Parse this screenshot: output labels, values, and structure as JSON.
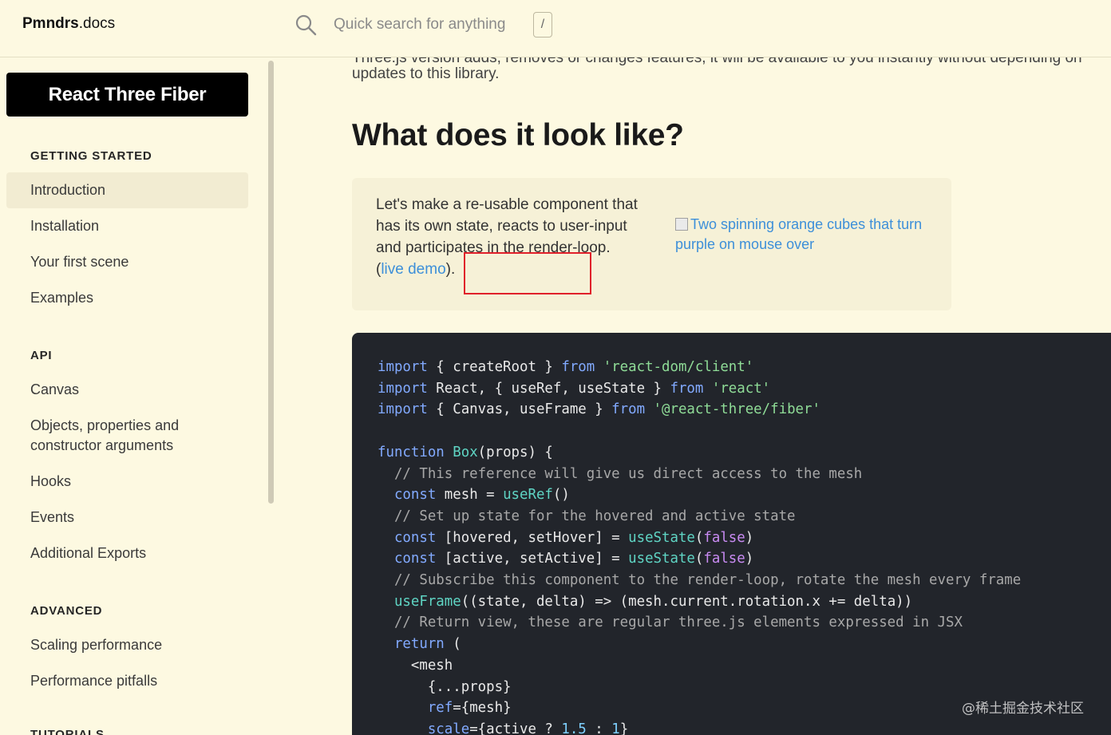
{
  "header": {
    "logo_bold": "Pmndrs",
    "logo_thin": ".docs",
    "search_placeholder": "Quick search for anything",
    "shortcut_key": "/"
  },
  "sidebar": {
    "brand": "React Three Fiber",
    "sections": [
      {
        "title": "GETTING STARTED",
        "items": [
          "Introduction",
          "Installation",
          "Your first scene",
          "Examples"
        ]
      },
      {
        "title": "API",
        "items": [
          "Canvas",
          "Objects, properties and constructor arguments",
          "Hooks",
          "Events",
          "Additional Exports"
        ]
      },
      {
        "title": "ADVANCED",
        "items": [
          "Scaling performance",
          "Performance pitfalls"
        ]
      },
      {
        "title": "TUTORIALS",
        "items": []
      }
    ],
    "active_item": "Introduction"
  },
  "main": {
    "cut_line": "Three.js version adds, removes or changes features, it will be available to you instantly without depending on",
    "intro_tail": "updates to this library.",
    "heading": "What does it look like?",
    "callout": {
      "text": "Let's make a re-usable component that has its own state, reacts to user-input and participates in the render-loop. (",
      "link": "live demo",
      "text_after": ").",
      "image_alt": "Two spinning orange cubes that turn purple on mouse over"
    }
  },
  "watermark": "@稀土掘金技术社区"
}
